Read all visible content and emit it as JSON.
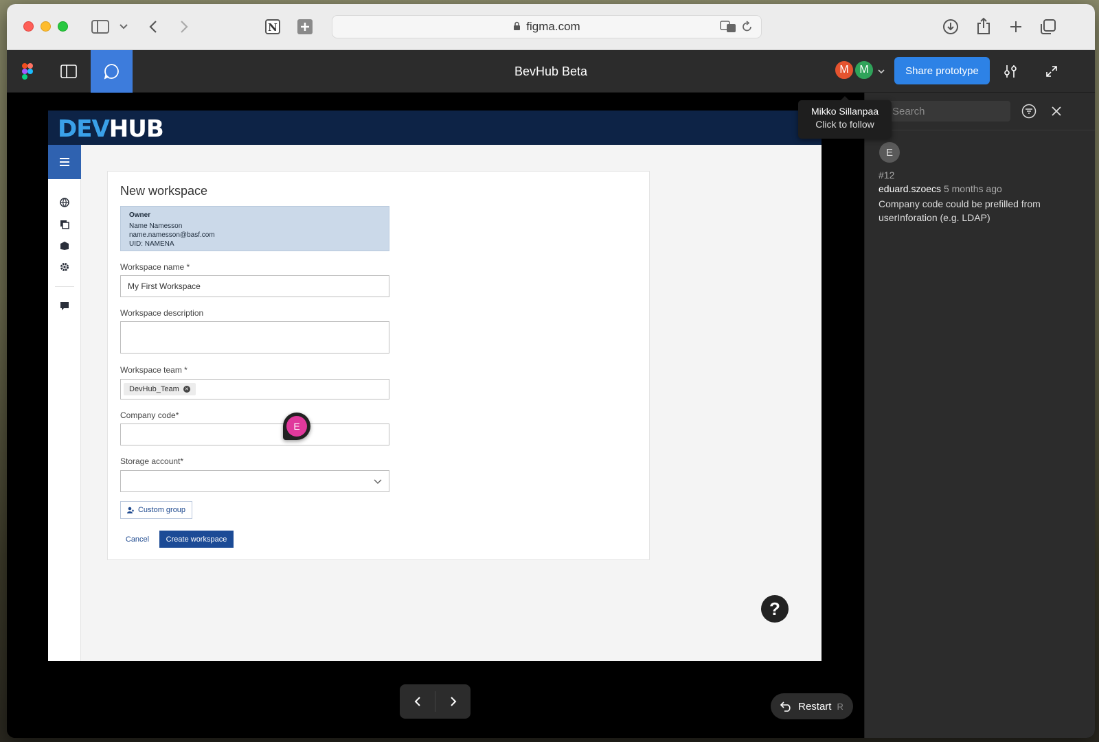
{
  "browser": {
    "url": "figma.com"
  },
  "figma": {
    "title": "BevHub Beta",
    "share_label": "Share prototype",
    "avatars": [
      {
        "initial": "M",
        "color": "#e5532f"
      },
      {
        "initial": "M",
        "color": "#2fa35a"
      }
    ],
    "tooltip": {
      "name": "Mikko Sillanpaa",
      "hint": "Click to follow"
    }
  },
  "app": {
    "logo_dev": "DEV",
    "logo_hub": "HUB",
    "form": {
      "title": "New workspace",
      "owner_label": "Owner",
      "owner_name": "Name Namesson",
      "owner_email": "name.namesson@basf.com",
      "owner_uid": "UID: NAMENA",
      "workspace_name_label": "Workspace name *",
      "workspace_name_value": "My First Workspace",
      "workspace_desc_label": "Workspace description",
      "workspace_team_label": "Workspace team *",
      "team_chip": "DevHub_Team",
      "company_code_label": "Company code*",
      "storage_label": "Storage account*",
      "custom_group_label": "Custom group",
      "cancel_label": "Cancel",
      "create_label": "Create workspace"
    },
    "pin_initial": "E",
    "help_symbol": "?"
  },
  "canvas": {
    "restart_label": "Restart",
    "restart_key": "R"
  },
  "comments": {
    "search_placeholder": "Search",
    "items": [
      {
        "initial": "E",
        "number": "#12",
        "author": "eduard.szoecs",
        "time": "5 months ago",
        "body": "Company code could be prefilled from userInforation (e.g. LDAP)"
      }
    ]
  },
  "colors": {
    "accent": "#2d82e6",
    "devhub_navy": "#0d2346",
    "primary_button": "#1c4b96",
    "pin": "#e0399c"
  }
}
